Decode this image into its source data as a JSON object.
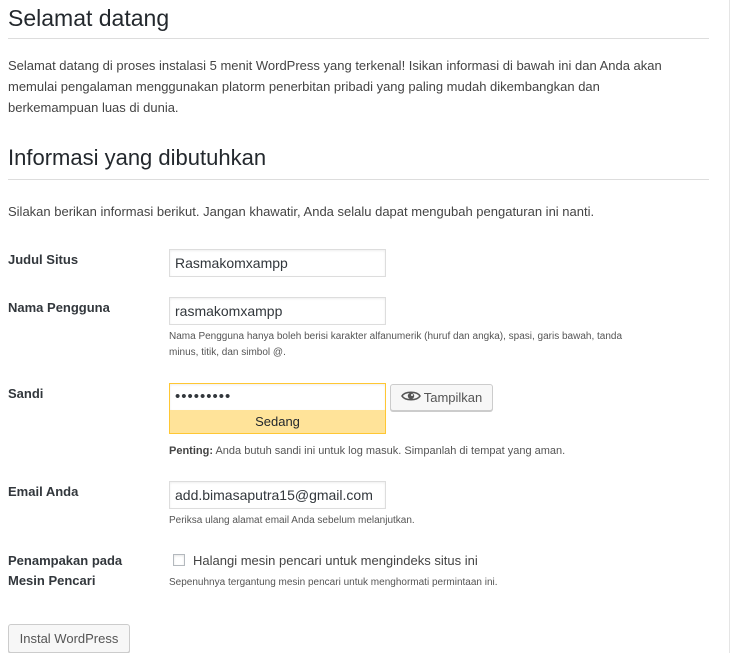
{
  "welcome": {
    "title": "Selamat datang",
    "intro_line1": "Selamat datang di proses instalasi 5 menit WordPress yang terkenal! Isikan informasi di bawah ini dan Anda akan",
    "intro_line2": "memulai pengalaman menggunakan platorm penerbitan pribadi yang paling mudah dikembangkan dan",
    "intro_line3": "berkemampuan luas di dunia."
  },
  "info": {
    "title": "Informasi yang dibutuhkan",
    "subtitle": "Silakan berikan informasi berikut. Jangan khawatir, Anda selalu dapat mengubah pengaturan ini nanti."
  },
  "form": {
    "site_title": {
      "label": "Judul Situs",
      "value": "Rasmakomxampp"
    },
    "username": {
      "label": "Nama Pengguna",
      "value": "rasmakomxampp",
      "help_line1": "Nama Pengguna hanya boleh berisi karakter alfanumerik (huruf dan angka), spasi, garis bawah, tanda",
      "help_line2": "minus, titik, dan simbol @."
    },
    "password": {
      "label": "Sandi",
      "masked_value": "•••••••••",
      "strength": "Sedang",
      "strength_color": "#ffe399",
      "show_button": "Tampilkan",
      "show_icon": "eye-icon",
      "important_prefix": "Penting:",
      "important_text": " Anda butuh sandi ini untuk log masuk. Simpanlah di tempat yang aman."
    },
    "email": {
      "label": "Email Anda",
      "value": "add.bimasaputra15@gmail.com",
      "help": "Periksa ulang alamat email Anda sebelum melanjutkan."
    },
    "visibility": {
      "label_line1": "Penampakan pada",
      "label_line2": "Mesin Pencari",
      "checkbox_label": "Halangi mesin pencari untuk mengindeks situs ini",
      "checked": false,
      "help": "Sepenuhnya tergantung mesin pencari untuk menghormati permintaan ini."
    }
  },
  "install_button": "Instal WordPress"
}
